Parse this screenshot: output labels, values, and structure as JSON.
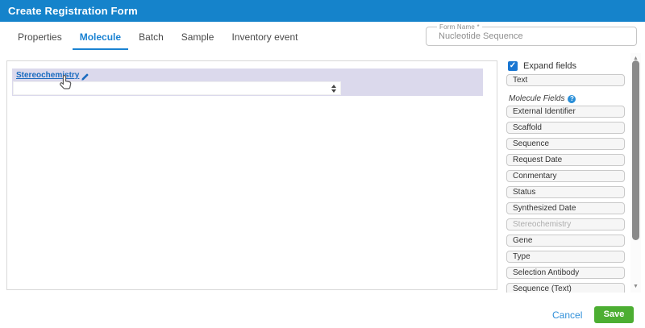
{
  "colors": {
    "header_bg": "#1583cb",
    "accent_blue": "#1a82d2",
    "link_blue": "#1a6bbf",
    "field_block_lavender": "#dbd9ec",
    "save_green": "#4cae32",
    "cancel_blue": "#2f8fd9",
    "scrollbar_thumb": "#8a8a8a"
  },
  "header": {
    "title": "Create Registration Form"
  },
  "tabs": [
    {
      "label": "Properties",
      "active": false
    },
    {
      "label": "Molecule",
      "active": true
    },
    {
      "label": "Batch",
      "active": false
    },
    {
      "label": "Sample",
      "active": false
    },
    {
      "label": "Inventory event",
      "active": false
    }
  ],
  "form_name": {
    "label": "Form Name *",
    "value": "Nucleotide Sequence"
  },
  "canvas": {
    "field": {
      "label": "Stereochemistry",
      "type": "select",
      "value": ""
    }
  },
  "sidebar": {
    "expand_fields": {
      "label": "Expand fields",
      "checked": true
    },
    "general_fields": [
      {
        "label": "Text"
      }
    ],
    "section": {
      "label": "Molecule Fields"
    },
    "molecule_fields": [
      {
        "label": "External Identifier",
        "disabled": false
      },
      {
        "label": "Scaffold",
        "disabled": false
      },
      {
        "label": "Sequence",
        "disabled": false
      },
      {
        "label": "Request Date",
        "disabled": false
      },
      {
        "label": "Conmentary",
        "disabled": false
      },
      {
        "label": "Status",
        "disabled": false
      },
      {
        "label": "Synthesized Date",
        "disabled": false
      },
      {
        "label": "Stereochemistry",
        "disabled": true
      },
      {
        "label": "Gene",
        "disabled": false
      },
      {
        "label": "Type",
        "disabled": false
      },
      {
        "label": "Selection Antibody",
        "disabled": false
      },
      {
        "label": "Sequence (Text)",
        "disabled": false
      }
    ]
  },
  "icons": {
    "checkbox_check": "✓",
    "help": "?",
    "scroll_up": "▲",
    "scroll_down": "▼"
  },
  "footer": {
    "cancel_label": "Cancel",
    "save_label": "Save"
  }
}
